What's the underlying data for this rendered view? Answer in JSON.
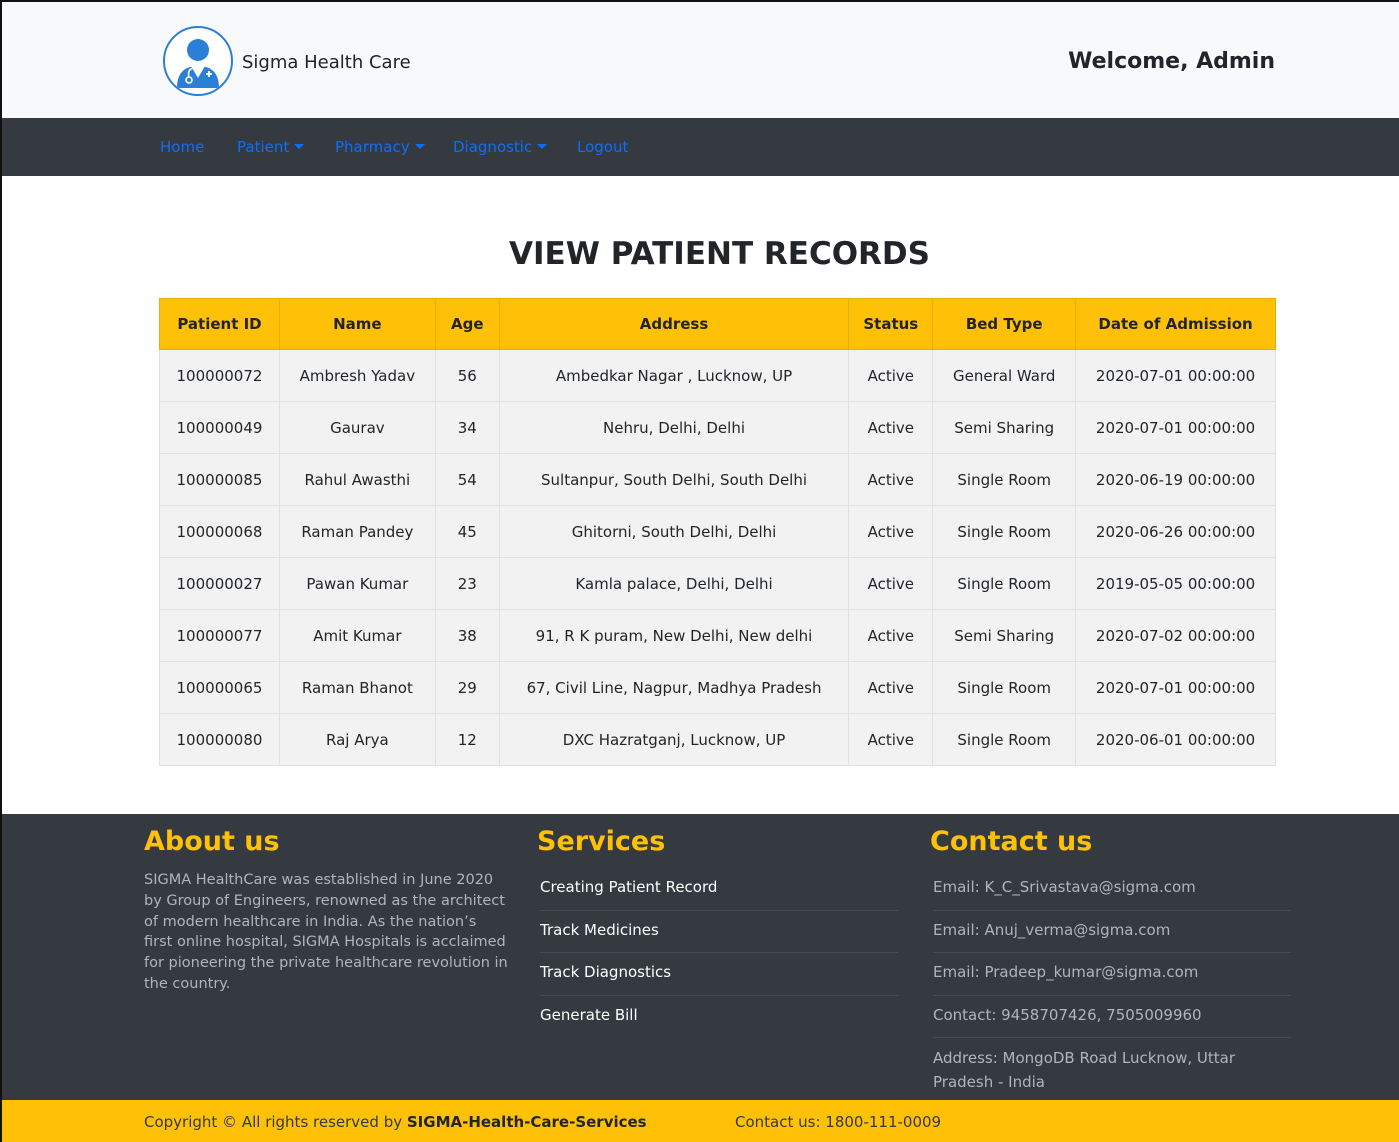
{
  "header": {
    "brand": "Sigma Health Care",
    "welcome": "Welcome, Admin",
    "logo_icon": "doctor-avatar-icon"
  },
  "nav": {
    "home": "Home",
    "patient": "Patient",
    "pharmacy": "Pharmacy",
    "diagnostic": "Diagnostic",
    "logout": "Logout",
    "link_color": "#0d6efd"
  },
  "page": {
    "title": "VIEW PATIENT RECORDS"
  },
  "table": {
    "headers": [
      "Patient ID",
      "Name",
      "Age",
      "Address",
      "Status",
      "Bed Type",
      "Date of Admission"
    ],
    "rows": [
      [
        "100000072",
        "Ambresh Yadav",
        "56",
        "Ambedkar Nagar , Lucknow, UP",
        "Active",
        "General Ward",
        "2020-07-01 00:00:00"
      ],
      [
        "100000049",
        "Gaurav",
        "34",
        "Nehru, Delhi, Delhi",
        "Active",
        "Semi Sharing",
        "2020-07-01 00:00:00"
      ],
      [
        "100000085",
        "Rahul Awasthi",
        "54",
        "Sultanpur, South Delhi, South Delhi",
        "Active",
        "Single Room",
        "2020-06-19 00:00:00"
      ],
      [
        "100000068",
        "Raman Pandey",
        "45",
        "Ghitorni, South Delhi, Delhi",
        "Active",
        "Single Room",
        "2020-06-26 00:00:00"
      ],
      [
        "100000027",
        "Pawan Kumar",
        "23",
        "Kamla palace, Delhi, Delhi",
        "Active",
        "Single Room",
        "2019-05-05 00:00:00"
      ],
      [
        "100000077",
        "Amit Kumar",
        "38",
        "91, R K puram, New Delhi, New delhi",
        "Active",
        "Semi Sharing",
        "2020-07-02 00:00:00"
      ],
      [
        "100000065",
        "Raman Bhanot",
        "29",
        "67, Civil Line, Nagpur, Madhya Pradesh",
        "Active",
        "Single Room",
        "2020-07-01 00:00:00"
      ],
      [
        "100000080",
        "Raj Arya",
        "12",
        "DXC Hazratganj, Lucknow, UP",
        "Active",
        "Single Room",
        "2020-06-01 00:00:00"
      ]
    ]
  },
  "footer": {
    "about": {
      "heading": "About us",
      "text": "SIGMA HealthCare was established in June 2020 by Group of Engineers, renowned as the architect of modern healthcare in India. As the nation’s first online hospital, SIGMA Hospitals is acclaimed for pioneering the private healthcare revolution in the country."
    },
    "services": {
      "heading": "Services",
      "items": [
        "Creating Patient Record",
        "Track Medicines",
        "Track Diagnostics",
        "Generate Bill"
      ]
    },
    "contact": {
      "heading": "Contact us",
      "items": [
        "Email: K_C_Srivastava@sigma.com",
        "Email: Anuj_verma@sigma.com",
        "Email: Pradeep_kumar@sigma.com",
        "Contact: 9458707426, 7505009960",
        "Address: MongoDB Road Lucknow, Uttar Pradesh - India"
      ]
    },
    "accent_color": "#ffc107"
  },
  "bottom_bar": {
    "copyright_prefix": "Copyright © All rights reserved by",
    "company": "SIGMA-Health-Care-Services",
    "contact": "Contact us: 1800-111-0009"
  }
}
